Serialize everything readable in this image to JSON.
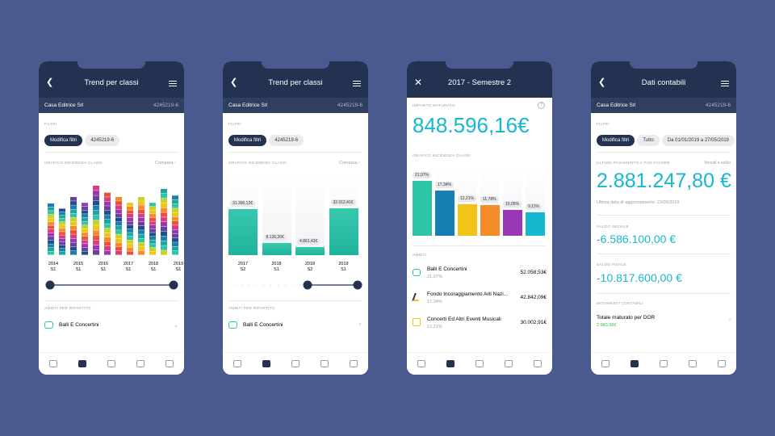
{
  "screens": [
    {
      "title": "Trend per classi",
      "company": "Casa Editrice Srl",
      "code": "4245219-6",
      "filters_label": "FILTRI",
      "filter_chips": [
        "Modifica filtri",
        "4245219-6"
      ],
      "chart_label": "GRAFICO INCIDENZA CLASSI",
      "compare_label": "Compara",
      "periods": [
        {
          "year": "2014",
          "sem": "S1"
        },
        {
          "year": "2015",
          "sem": "S1"
        },
        {
          "year": "2016",
          "sem": "S1"
        },
        {
          "year": "2017",
          "sem": "S1"
        },
        {
          "year": "2018",
          "sem": "S1"
        },
        {
          "year": "2019",
          "sem": "S1"
        }
      ],
      "ambiti_label": "AMBITI PER RIPARTITO",
      "ambito_item": "Balli E Concertini"
    },
    {
      "title": "Trend per classi",
      "company": "Casa Editrice Srl",
      "code": "4245219-6",
      "filters_label": "FILTRI",
      "filter_chips": [
        "Modifica filtri",
        "4245219-6"
      ],
      "chart_label": "GRAFICO INCIDENZA CLASSI",
      "compare_label": "Compara",
      "ambiti_label": "AMBITI PER RIPARTITO",
      "ambito_item": "Balli E Concertini"
    },
    {
      "title": "2017 - Semestre 2",
      "amount_label": "IMPORTO MATURATO",
      "amount": "848.596,16€",
      "chart_label": "GRAFICO INCIDENZA CLASSI",
      "ambiti_label": "AMBITI",
      "ambiti": [
        {
          "name": "Balli E Concertini",
          "pct": "21,07%",
          "amount": "52.058,53€",
          "icon": "masks-icon"
        },
        {
          "name": "Fondo Incoraggiamento Arti Nazi...",
          "pct": "17,34%",
          "amount": "42.842,09€",
          "icon": "dancer-icon"
        },
        {
          "name": "Concerti Ed Altri Eventi Musicali",
          "pct": "12,21%",
          "amount": "30.002,91€",
          "icon": "ticket-icon"
        }
      ]
    },
    {
      "title": "Dati contabili",
      "company": "Casa Editrice Srl",
      "code": "4245219-6",
      "filters_label": "FILTRI",
      "filter_chips": [
        "Modifica filtri",
        "Tutto",
        "Da 01/01/2019 a 27/05/2019"
      ],
      "last_payment_label": "ULTIMO PAGAMENTO A TUO FAVORE",
      "last_payment_link": "Versati a saldo",
      "last_payment": "2.881.247,80 €",
      "updated": "Ultima data di aggiornamento: 22/05/2019",
      "initial_label": "SALDO INIZIALE",
      "initial": "-6.586.100,00 €",
      "final_label": "SALDO FINALE",
      "final": "-10.817.600,00 €",
      "movements_label": "MOVIMENTI CONTABILI",
      "movement_name": "Totale maturato per DOR",
      "movement_value": "2.983,96€"
    }
  ],
  "chart_data": [
    {
      "type": "bar",
      "stacked": true,
      "categories": [
        "2014 S1",
        "2015 S1",
        "2016 S1",
        "2017 S1",
        "2018 S1",
        "2019 S1"
      ],
      "relative_heights_pct": [
        64,
        72,
        86,
        72,
        72,
        82
      ],
      "colors": [
        "#2ec4a6",
        "#1ba6a0",
        "#177fb1",
        "#1f4e8c",
        "#6a3fa0",
        "#9a37b5",
        "#d93d7a",
        "#ef4f3a",
        "#f58c2a",
        "#f2c418",
        "#c9d21c"
      ]
    },
    {
      "type": "bar",
      "categories": [
        "2017 S2",
        "2018 S1",
        "2018 S2",
        "2019 S1"
      ],
      "values": [
        31390.12,
        8126.2,
        4861.43,
        32012.41
      ],
      "labels": [
        "31.390,12€",
        "8.126,20€",
        "4.861,43€",
        "32.012,41€"
      ]
    },
    {
      "type": "bar",
      "values_pct": [
        21.07,
        17.34,
        12.21,
        11.78,
        10.05,
        9.11
      ],
      "labels": [
        "21,07%",
        "17,34%",
        "12,21%",
        "11,78%",
        "10,05%",
        "9,11%"
      ],
      "colors": [
        "#2ec4a6",
        "#177fb1",
        "#f2c418",
        "#f58c2a",
        "#9a37b5",
        "#16b7cf"
      ]
    }
  ]
}
